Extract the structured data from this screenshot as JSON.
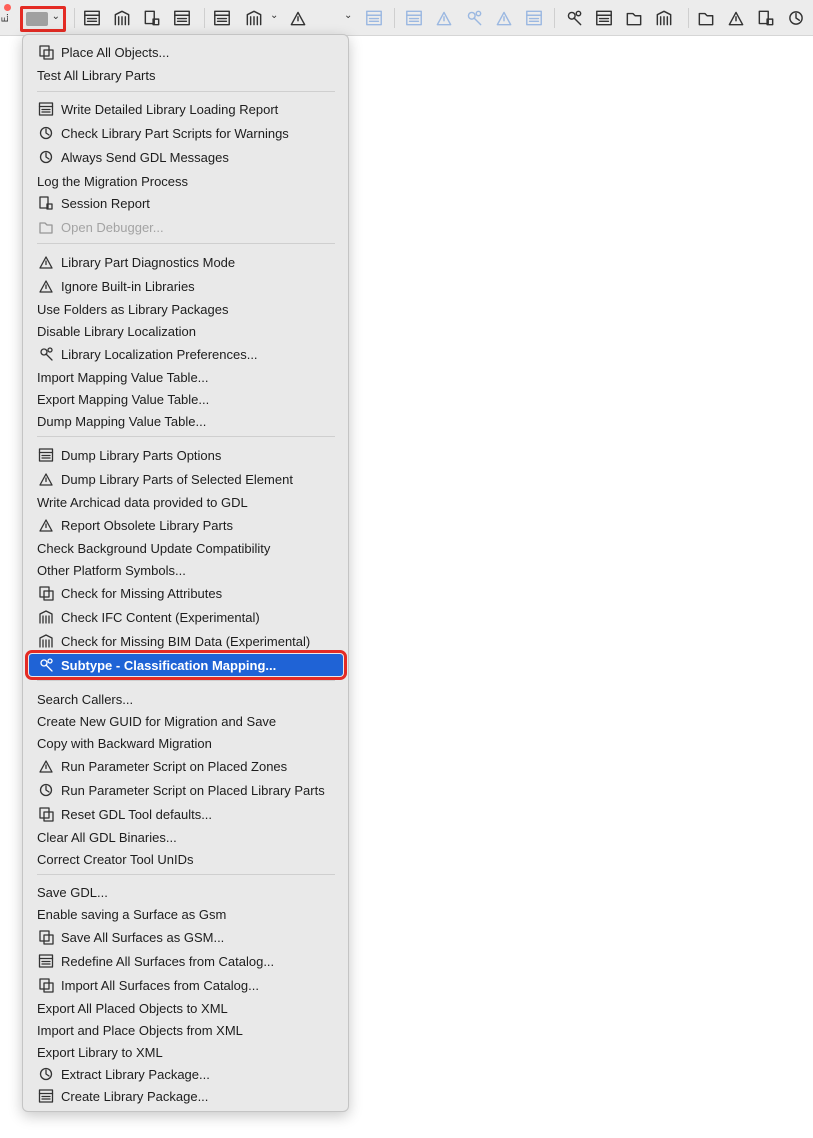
{
  "toolbar": {
    "edge_label": "E..",
    "icons": [
      "library-buildings-icon",
      "library-refresh-icon",
      "library-upload-icon",
      "library-sync-icon",
      "library-part-icon",
      "arrow-person-icon",
      "tree-structure-icon",
      "globe-icon",
      "magnify-shape-icon",
      "swap-arrows-icon",
      "zoom-shape-icon",
      "inspect-icon",
      "run-script-icon",
      "indent-list-icon",
      "list-warning-icon",
      "list-lines-icon",
      "guid-icon",
      "code-check-icon",
      "hammer-tools-icon",
      "window-list-icon",
      "settings-gears-icon"
    ]
  },
  "menu": {
    "groups": [
      [
        {
          "label": "Place All Objects...",
          "icon": "place-objects-icon"
        },
        {
          "label": "Test All Library Parts",
          "icon": ""
        }
      ],
      [
        {
          "label": "Write Detailed Library Loading Report",
          "icon": "report-table-icon"
        },
        {
          "label": "Check Library Part Scripts for Warnings",
          "icon": "script-warning-icon"
        },
        {
          "label": "Always Send GDL Messages",
          "icon": "send-message-icon"
        },
        {
          "label": "Log the Migration Process",
          "icon": ""
        },
        {
          "label": "Session Report",
          "icon": "session-report-icon"
        },
        {
          "label": "Open Debugger...",
          "icon": "debugger-bug-icon",
          "disabled": true
        }
      ],
      [
        {
          "label": "Library Part Diagnostics Mode",
          "icon": "diagnostics-icon"
        },
        {
          "label": "Ignore Built-in Libraries",
          "icon": "folder-library-icon"
        },
        {
          "label": "Use Folders as Library Packages",
          "icon": ""
        },
        {
          "label": "Disable Library Localization",
          "icon": ""
        },
        {
          "label": "Library Localization Preferences...",
          "icon": "library-location-icon"
        },
        {
          "label": "Import Mapping Value Table...",
          "icon": ""
        },
        {
          "label": "Export Mapping Value Table...",
          "icon": ""
        },
        {
          "label": "Dump Mapping Value Table...",
          "icon": ""
        }
      ],
      [
        {
          "label": "Dump Library Parts Options",
          "icon": "dump-options-icon"
        },
        {
          "label": "Dump Library Parts of Selected Element",
          "icon": "dump-selected-icon"
        },
        {
          "label": "Write Archicad data provided to GDL",
          "icon": ""
        },
        {
          "label": "Report Obsolete Library Parts",
          "icon": "obsolete-parts-icon"
        },
        {
          "label": "Check Background Update Compatibility",
          "icon": ""
        },
        {
          "label": "Other Platform Symbols...",
          "icon": ""
        },
        {
          "label": "Check for Missing Attributes",
          "icon": "missing-attributes-icon"
        },
        {
          "label": "Check IFC Content (Experimental)",
          "icon": "ifc-check-icon"
        },
        {
          "label": "Check for Missing BIM Data (Experimental)",
          "icon": "bim-data-icon"
        },
        {
          "label": "Subtype - Classification Mapping...",
          "icon": "classification-mapping-icon",
          "selected": true
        }
      ],
      [
        {
          "label": "Search Callers...",
          "icon": ""
        },
        {
          "label": "Create New GUID for Migration and Save",
          "icon": ""
        },
        {
          "label": "Copy with Backward Migration",
          "icon": ""
        },
        {
          "label": "Run Parameter Script on Placed Zones",
          "icon": "zone-script-icon"
        },
        {
          "label": "Run Parameter Script on Placed Library Parts",
          "icon": "refresh-circle-icon"
        },
        {
          "label": "Reset GDL Tool defaults...",
          "icon": "reset-tool-icon"
        },
        {
          "label": "Clear All GDL Binaries...",
          "icon": ""
        },
        {
          "label": "Correct Creator Tool UnIDs",
          "icon": ""
        }
      ],
      [
        {
          "label": "Save GDL...",
          "icon": ""
        },
        {
          "label": "Enable saving a Surface as Gsm",
          "icon": ""
        },
        {
          "label": "Save All Surfaces as GSM...",
          "icon": "save-surfaces-icon"
        },
        {
          "label": "Redefine All Surfaces from Catalog...",
          "icon": "redefine-surfaces-icon"
        },
        {
          "label": "Import All Surfaces from Catalog...",
          "icon": "import-surfaces-icon"
        },
        {
          "label": "Export All Placed Objects to XML",
          "icon": ""
        },
        {
          "label": "Import and Place Objects from XML",
          "icon": ""
        },
        {
          "label": "Export Library to XML",
          "icon": ""
        },
        {
          "label": "Extract Library Package...",
          "icon": "extract-package-icon"
        },
        {
          "label": "Create Library Package...",
          "icon": "create-package-icon"
        }
      ]
    ]
  }
}
